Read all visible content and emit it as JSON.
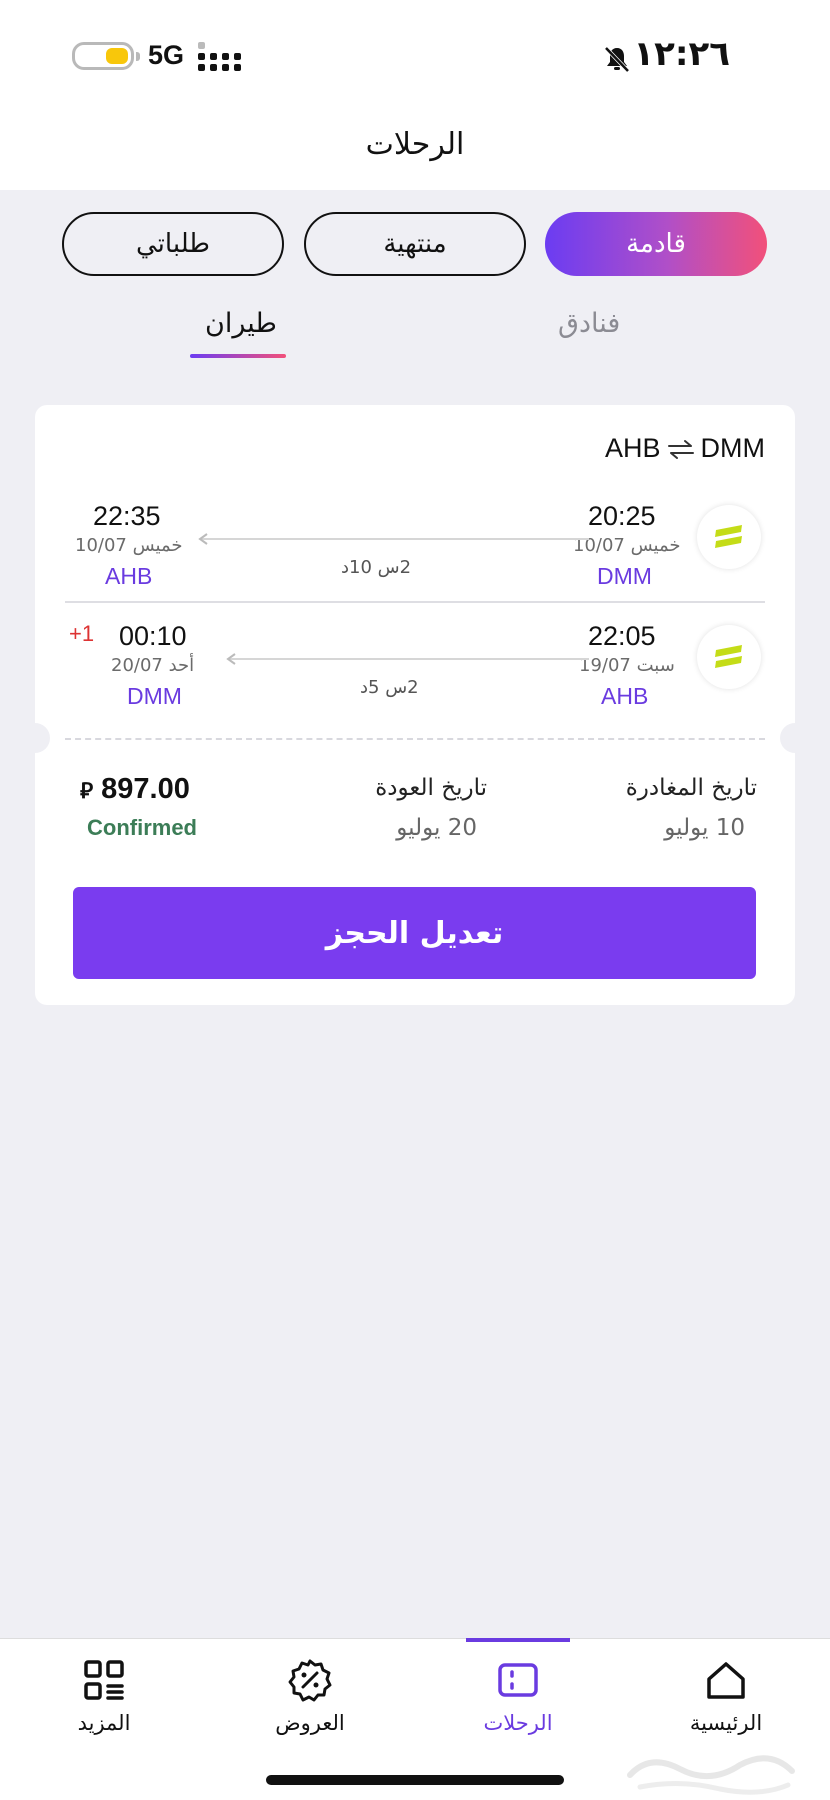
{
  "status_bar": {
    "time": "١٢:٢٦",
    "network": "5G"
  },
  "header": {
    "title": "الرحلات"
  },
  "segments": [
    {
      "label": "قادمة",
      "active": true
    },
    {
      "label": "منتهية",
      "active": false
    },
    {
      "label": "طلباتي",
      "active": false
    }
  ],
  "subtabs": [
    {
      "label": "فنادق",
      "active": false
    },
    {
      "label": "طيران",
      "active": true
    }
  ],
  "trip": {
    "route": {
      "from": "DMM",
      "to": "AHB"
    },
    "outbound": {
      "departure_time": "20:25",
      "departure_date": "خميس 10/07",
      "departure_code": "DMM",
      "arrival_time": "22:35",
      "arrival_date": "خميس 10/07",
      "arrival_code": "AHB",
      "duration": "2س 10د"
    },
    "return": {
      "departure_time": "22:05",
      "departure_date": "سبت 19/07",
      "departure_code": "AHB",
      "arrival_time": "00:10",
      "arrival_date": "أحد 20/07",
      "arrival_code": "DMM",
      "duration": "2س 5د",
      "day_offset": "+1"
    },
    "departure_label": "تاريخ المغادرة",
    "departure_value": "10 يوليو",
    "return_label": "تاريخ العودة",
    "return_value": "20 يوليو",
    "price": "897.00",
    "currency_symbol": "⃁",
    "status": "Confirmed",
    "action_label": "تعديل الحجز"
  },
  "bottom_nav": [
    {
      "label": "الرئيسية",
      "icon": "home-icon",
      "active": false
    },
    {
      "label": "الرحلات",
      "icon": "trips-icon",
      "active": true
    },
    {
      "label": "العروض",
      "icon": "discount-icon",
      "active": false
    },
    {
      "label": "المزيد",
      "icon": "more-grid-icon",
      "active": false
    }
  ],
  "colors": {
    "accent": "#6a3be0",
    "button": "#7a3cef",
    "status_confirmed": "#3c7d57",
    "gradient_start": "#6b3cf2",
    "gradient_end": "#f2507a",
    "airline_logo": "#c4dc17"
  }
}
